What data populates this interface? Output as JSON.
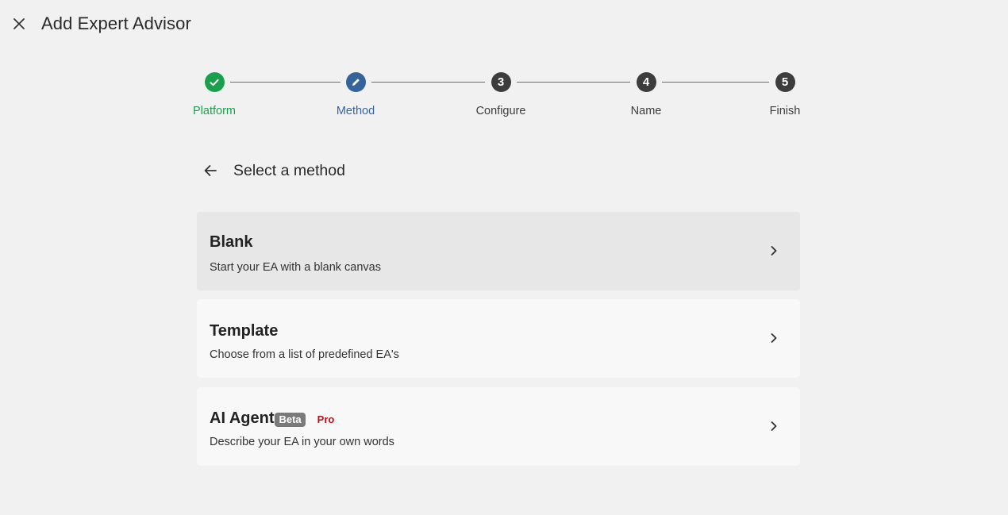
{
  "header": {
    "title": "Add Expert Advisor",
    "close_icon": "close-icon"
  },
  "stepper": {
    "steps": [
      {
        "number": "",
        "label": "Platform",
        "state": "complete",
        "icon": "check-icon",
        "color": "#1aa04d"
      },
      {
        "number": "",
        "label": "Method",
        "state": "active",
        "icon": "pencil-icon",
        "color": "#34649a"
      },
      {
        "number": "3",
        "label": "Configure",
        "state": "pending",
        "color": "#3d3d3d"
      },
      {
        "number": "4",
        "label": "Name",
        "state": "pending",
        "color": "#3d3d3d"
      },
      {
        "number": "5",
        "label": "Finish",
        "state": "pending",
        "color": "#3d3d3d"
      }
    ]
  },
  "section": {
    "title": "Select a method",
    "back_icon": "arrow-left-icon"
  },
  "methods": [
    {
      "title": "Blank",
      "description": "Start your EA with a blank canvas",
      "highlighted": true
    },
    {
      "title": "Template",
      "description": "Choose from a list of predefined EA's",
      "highlighted": false
    },
    {
      "title": "AI Agent",
      "description": "Describe your EA in your own words",
      "badge": "Beta",
      "tag": "Pro",
      "tag_color": "#b5121b",
      "highlighted": false
    }
  ]
}
